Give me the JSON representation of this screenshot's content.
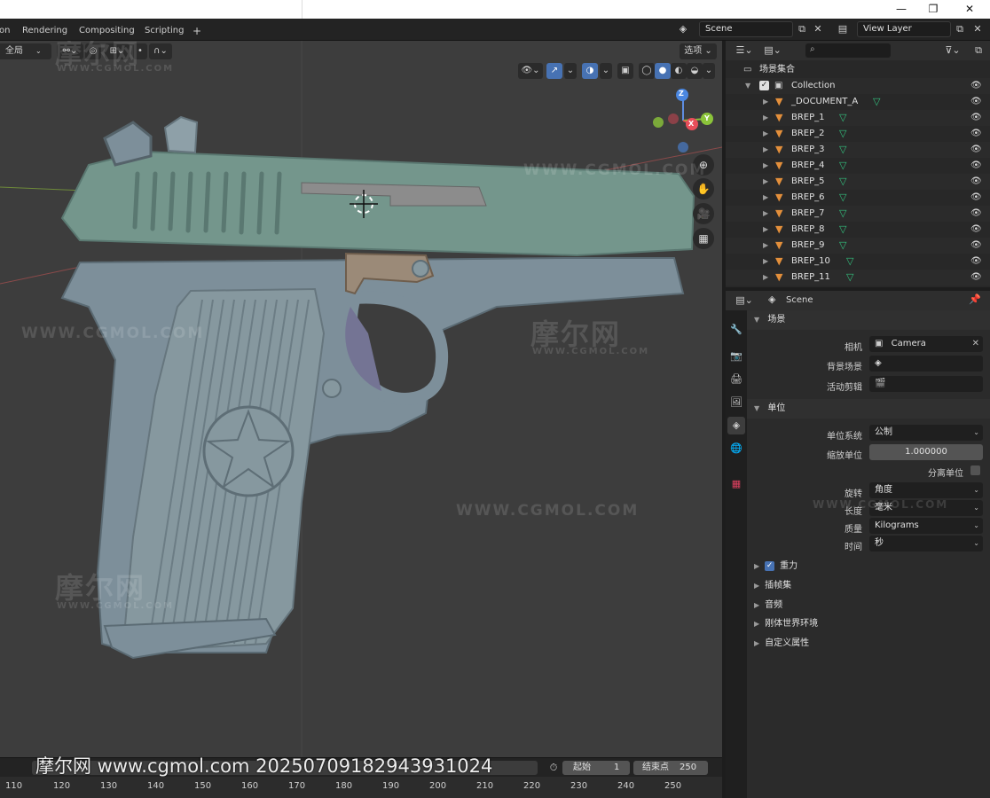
{
  "window": {
    "minimize": "—",
    "maximize": "❐",
    "close": "✕"
  },
  "topbar": {
    "tabs": [
      {
        "label": "on"
      },
      {
        "label": "Rendering"
      },
      {
        "label": "Compositing"
      },
      {
        "label": "Scripting"
      },
      {
        "label": "+"
      }
    ],
    "scene_value": "Scene",
    "view_layer_value": "View Layer"
  },
  "viewport": {
    "orientation": "全局",
    "options_label": "选项",
    "gizmo": {
      "z": "Z",
      "y": "Y",
      "x": "X"
    }
  },
  "watermarks": {
    "brand_cn": "摩尔网",
    "site": "WWW.CGMOL.COM",
    "footer": "摩尔网 www.cgmol.com 20250709182943931024"
  },
  "timeline": {
    "start_label": "起始",
    "start_value": "1",
    "end_label": "结束点",
    "end_value": "250",
    "ticks": [
      "110",
      "120",
      "130",
      "140",
      "150",
      "160",
      "170",
      "180",
      "190",
      "200",
      "210",
      "220",
      "230",
      "240",
      "250"
    ]
  },
  "outliner": {
    "root_label": "场景集合",
    "collection_label": "Collection",
    "items": [
      {
        "label": "_DOCUMENT_A"
      },
      {
        "label": "BREP_1"
      },
      {
        "label": "BREP_2"
      },
      {
        "label": "BREP_3"
      },
      {
        "label": "BREP_4"
      },
      {
        "label": "BREP_5"
      },
      {
        "label": "BREP_6"
      },
      {
        "label": "BREP_7"
      },
      {
        "label": "BREP_8"
      },
      {
        "label": "BREP_9"
      },
      {
        "label": "BREP_10"
      },
      {
        "label": "BREP_11"
      }
    ]
  },
  "properties": {
    "header_scene": "Scene",
    "scene_section": "场景",
    "camera_label": "相机",
    "camera_value": "Camera",
    "background_scene_label": "背景场景",
    "active_clip_label": "活动剪辑",
    "units_section": "单位",
    "unit_system_label": "单位系统",
    "unit_system_value": "公制",
    "unit_scale_label": "缩放单位",
    "unit_scale_value": "1.000000",
    "separate_units_label": "分离单位",
    "rotation_label": "旋转",
    "rotation_value": "角度",
    "length_label": "长度",
    "length_value": "毫米",
    "mass_label": "质量",
    "mass_value": "Kilograms",
    "time_label": "时间",
    "time_value": "秒",
    "gravity_label": "重力",
    "keying_sets_label": "插帧集",
    "audio_label": "音频",
    "rigid_body_label": "刚体世界环境",
    "custom_props_label": "自定义属性"
  }
}
